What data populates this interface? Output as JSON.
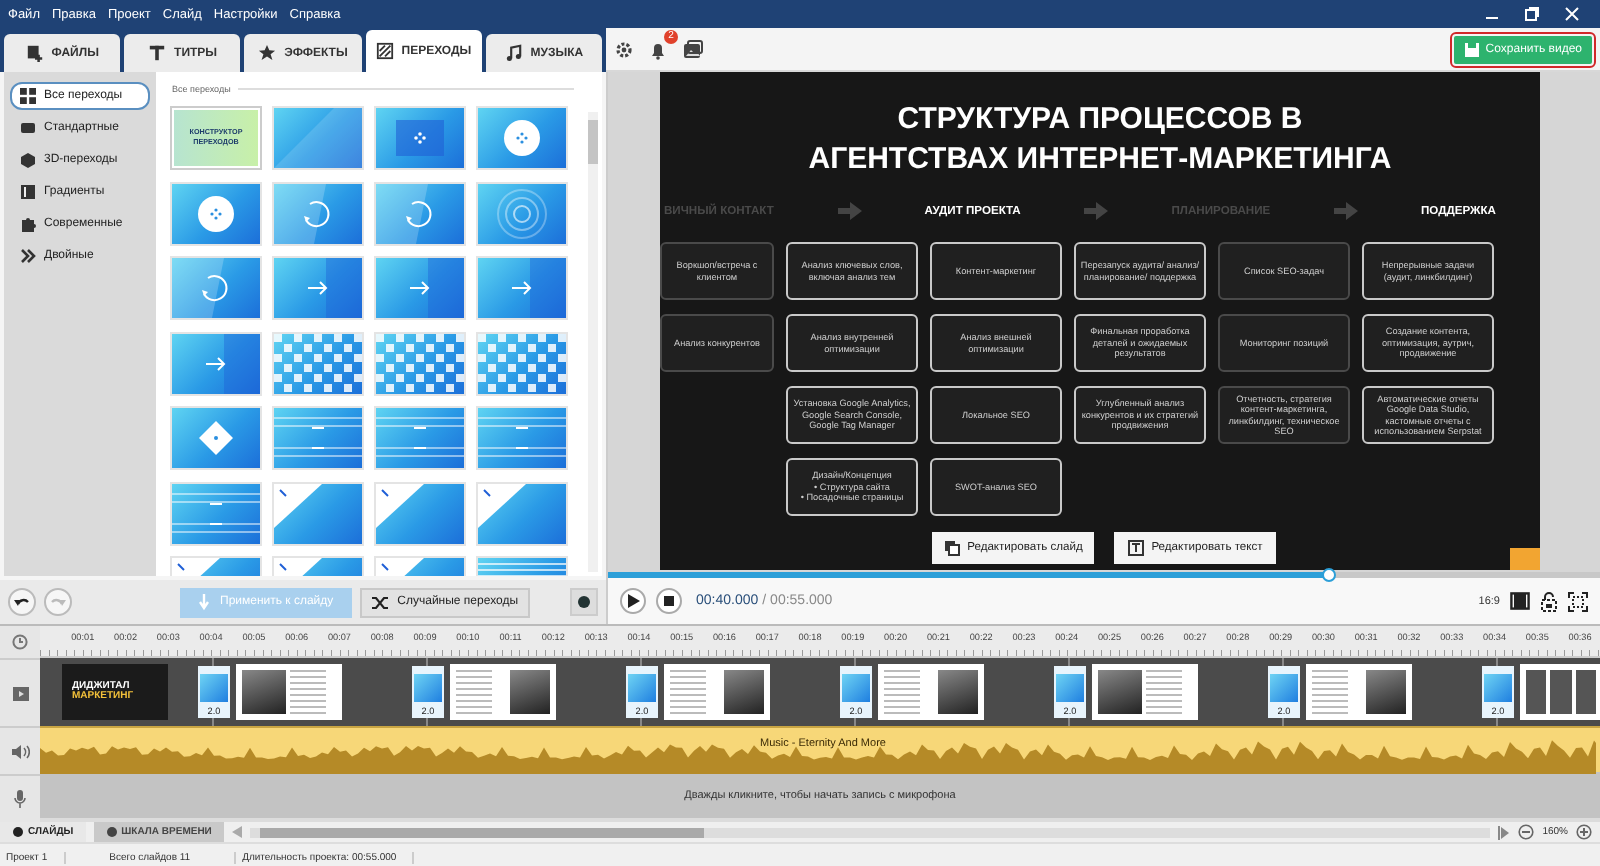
{
  "menu": [
    "Файл",
    "Правка",
    "Проект",
    "Слайд",
    "Настройки",
    "Справка"
  ],
  "tabs": [
    {
      "label": "ФАЙЛЫ",
      "kind": "files",
      "selected": false
    },
    {
      "label": "ТИТРЫ",
      "kind": "titles",
      "selected": false
    },
    {
      "label": "ЭФФЕКТЫ",
      "kind": "effects",
      "selected": false
    },
    {
      "label": "ПЕРЕХОДЫ",
      "kind": "transitions",
      "selected": true
    },
    {
      "label": "МУЗЫКА",
      "kind": "music",
      "selected": false
    }
  ],
  "toolbar": {
    "notifications": "2",
    "save_button": "Сохранить видео"
  },
  "categories": [
    {
      "label": "Все переходы",
      "selected": true
    },
    {
      "label": "Стандартные",
      "selected": false
    },
    {
      "label": "3D-переходы",
      "selected": false
    },
    {
      "label": "Градиенты",
      "selected": false
    },
    {
      "label": "Современные",
      "selected": false
    },
    {
      "label": "Двойные",
      "selected": false
    }
  ],
  "gallery": {
    "title": "Все переходы",
    "items": [
      {
        "kind": "builder",
        "label": "КОНСТРУКТОР ПЕРЕХОДОВ"
      },
      {
        "kind": "plain"
      },
      {
        "kind": "cross"
      },
      {
        "kind": "circle"
      },
      {
        "kind": "circle"
      },
      {
        "kind": "rotate"
      },
      {
        "kind": "rotate"
      },
      {
        "kind": "rings"
      },
      {
        "kind": "rotate"
      },
      {
        "kind": "arrow"
      },
      {
        "kind": "arrow"
      },
      {
        "kind": "arrow"
      },
      {
        "kind": "arrow"
      },
      {
        "kind": "checker"
      },
      {
        "kind": "checker"
      },
      {
        "kind": "checker"
      },
      {
        "kind": "diamond"
      },
      {
        "kind": "stripes"
      },
      {
        "kind": "stripes"
      },
      {
        "kind": "stripes"
      },
      {
        "kind": "stripes"
      },
      {
        "kind": "corner"
      },
      {
        "kind": "corner"
      },
      {
        "kind": "corner"
      },
      {
        "kind": "corner"
      },
      {
        "kind": "corner"
      },
      {
        "kind": "corner"
      },
      {
        "kind": "lines"
      }
    ]
  },
  "undo": {
    "disabled": false
  },
  "redo": {
    "disabled": true
  },
  "apply_button": {
    "label": "Применить к слайду",
    "disabled": true
  },
  "random_button": "Случайные переходы",
  "slide": {
    "title_lines": [
      "СТРУКТУРА ПРОЦЕССОВ В",
      "АГЕНТСТВАХ ИНТЕРНЕТ-МАРКЕТИНГА"
    ],
    "stages": [
      {
        "label": "ВИЧНЫЙ КОНТАКТ",
        "highlighted": false
      },
      {
        "label": "АУДИТ ПРОЕКТА",
        "highlighted": true
      },
      {
        "label": "ПЛАНИРОВАНИЕ",
        "highlighted": false
      },
      {
        "label": "ПОДДЕРЖКА",
        "highlighted": true
      }
    ],
    "columns": [
      {
        "highlighted": false,
        "cards": [
          {
            "text": "Воркшоп/встреча с клиентом"
          },
          {
            "text": "Анализ конкурентов"
          }
        ]
      },
      {
        "highlighted": true,
        "cards": [
          {
            "text": "Анализ ключевых слов, включая анализ тем"
          },
          {
            "text": "Анализ внутренней оптимизации"
          },
          {
            "text": "Установка Google Analytics, Google Search Console, Google Tag Manager"
          },
          {
            "text": "Дизайн/Концепция",
            "bullets": [
              "• Структура сайта",
              "• Посадочные страницы"
            ]
          }
        ]
      },
      {
        "highlighted": true,
        "cards": [
          {
            "text": "Контент-маркетинг"
          },
          {
            "text": "Анализ внешней оптимизации"
          },
          {
            "text": "Локальное SEO"
          },
          {
            "text": "SWOT-анализ SEO"
          }
        ]
      },
      {
        "highlighted": true,
        "cards": [
          {
            "text": "Перезапуск аудита/ анализ/планирование/ поддержка"
          },
          {
            "text": "Финальная проработка деталей и ожидаемых результатов"
          },
          {
            "text": "Углубленный анализ конкурентов и их стратегий продвижения"
          }
        ]
      },
      {
        "highlighted": false,
        "cards": [
          {
            "text": "Список SEO-задач"
          },
          {
            "text": "Мониторинг позиций"
          },
          {
            "text": "Отчетность, стратегия контент-маркетинга, линкбилдинг, техническое SEO"
          }
        ]
      },
      {
        "highlighted": true,
        "cards": [
          {
            "text": "Непрерывные задачи (аудит, линкбилдинг)"
          },
          {
            "text": "Создание контента, оптимизация, аутрич, продвижение"
          },
          {
            "text": "Автоматические отчеты Google Data Studio, кастомные отчеты с использованием Serpstat"
          }
        ]
      }
    ],
    "edit_buttons": [
      "Редактировать слайд",
      "Редактировать текст"
    ]
  },
  "player": {
    "level": 0.727,
    "time": "00:40.000",
    "duration": "/ 00:55.000",
    "aspect": "16:9"
  },
  "timeline": {
    "ticks": [
      "00:01",
      "00:02",
      "00:03",
      "00:04",
      "00:05",
      "00:06",
      "00:07",
      "00:08",
      "00:09",
      "00:10",
      "00:11",
      "00:12",
      "00:13",
      "00:14",
      "00:15",
      "00:16",
      "00:17",
      "00:18",
      "00:19",
      "00:20",
      "00:21",
      "00:22",
      "00:23",
      "00:24",
      "00:25",
      "00:26",
      "00:27",
      "00:28",
      "00:29",
      "00:30",
      "00:31",
      "00:32",
      "00:33",
      "00:34",
      "00:35",
      "00:36"
    ],
    "clips": [
      {
        "kind": "dark",
        "lines": [
          "ДИДЖИТАЛ",
          "МАРКЕТИНГ"
        ],
        "transition": "2.0"
      },
      {
        "kind": "photo-left",
        "transition": "2.0"
      },
      {
        "kind": "photo-right",
        "transition": "2.0"
      },
      {
        "kind": "photo-right",
        "transition": "2.0"
      },
      {
        "kind": "photo-right",
        "transition": "2.0"
      },
      {
        "kind": "photo-left",
        "transition": "2.0"
      },
      {
        "kind": "photo-right",
        "transition": "2.0"
      },
      {
        "kind": "grid"
      }
    ],
    "audio": "Music - Eternity And More",
    "mic_hint": "Дважды кликните, чтобы начать запись с микрофона"
  },
  "view_tabs": [
    {
      "label": "СЛАЙДЫ",
      "selected": true
    },
    {
      "label": "ШКАЛА ВРЕМЕНИ",
      "selected": false
    }
  ],
  "zoom": "160%",
  "status": [
    "Проект 1",
    "Всего слайдов 11",
    "Длительность проекта: 00:55.000"
  ]
}
